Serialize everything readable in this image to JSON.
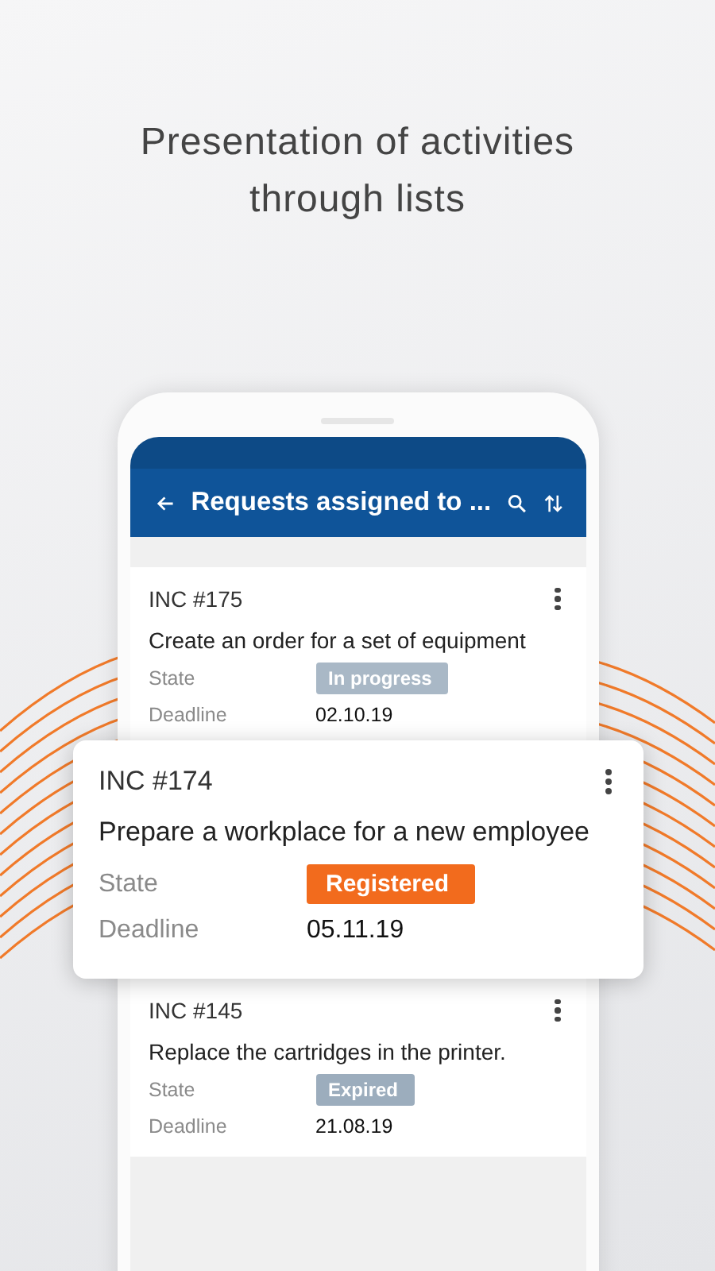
{
  "headline": "Presentation of activities through lists",
  "app_bar": {
    "title": "Requests assigned to ..."
  },
  "requests": [
    {
      "id": "INC #175",
      "title": "Create an order for a set of equipment",
      "state_label": "State",
      "state": "In progress",
      "color": "#a9b8c6",
      "deadline_label": "Deadline",
      "deadline": "02.10.19",
      "raised": false
    },
    {
      "id": "INC #174",
      "title": "Prepare a workplace for a new employee",
      "state_label": "State",
      "state": "Registered",
      "color": "#f26b1d",
      "deadline_label": "Deadline",
      "deadline": "05.11.19",
      "raised": true
    },
    {
      "id": "INC #145",
      "title": "Replace the cartridges in the printer.",
      "state_label": "State",
      "state": "Expired",
      "color": "#9cadbd",
      "deadline_label": "Deadline",
      "deadline": "21.08.19",
      "raised": false
    }
  ]
}
